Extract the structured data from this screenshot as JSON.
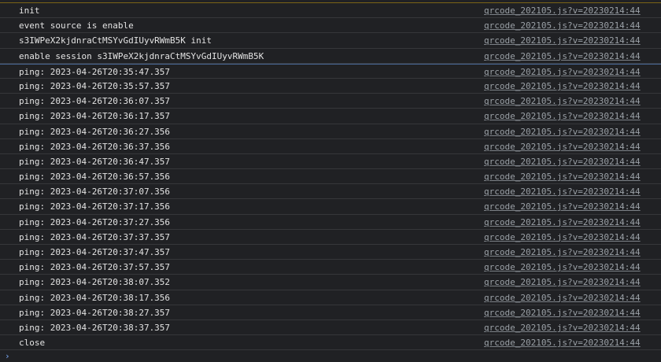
{
  "colors": {
    "background": "#202124",
    "text": "#e3e3e3",
    "source_link": "#9aa0a6",
    "prompt": "#7cacf8"
  },
  "top_fragment": "",
  "console": {
    "selected_row": 4,
    "entries": [
      {
        "message": "init",
        "source": "qrcode_202105.js?v=20230214:44"
      },
      {
        "message": "event source is enable",
        "source": "qrcode_202105.js?v=20230214:44"
      },
      {
        "message": "s3IWPeX2kjdnraCtMSYvGdIUyvRWmB5K init",
        "source": "qrcode_202105.js?v=20230214:44"
      },
      {
        "message": "enable session s3IWPeX2kjdnraCtMSYvGdIUyvRWmB5K",
        "source": "qrcode_202105.js?v=20230214:44"
      },
      {
        "message": "ping: 2023-04-26T20:35:47.357",
        "source": "qrcode_202105.js?v=20230214:44"
      },
      {
        "message": "ping: 2023-04-26T20:35:57.357",
        "source": "qrcode_202105.js?v=20230214:44"
      },
      {
        "message": "ping: 2023-04-26T20:36:07.357",
        "source": "qrcode_202105.js?v=20230214:44"
      },
      {
        "message": "ping: 2023-04-26T20:36:17.357",
        "source": "qrcode_202105.js?v=20230214:44"
      },
      {
        "message": "ping: 2023-04-26T20:36:27.356",
        "source": "qrcode_202105.js?v=20230214:44"
      },
      {
        "message": "ping: 2023-04-26T20:36:37.356",
        "source": "qrcode_202105.js?v=20230214:44"
      },
      {
        "message": "ping: 2023-04-26T20:36:47.357",
        "source": "qrcode_202105.js?v=20230214:44"
      },
      {
        "message": "ping: 2023-04-26T20:36:57.356",
        "source": "qrcode_202105.js?v=20230214:44"
      },
      {
        "message": "ping: 2023-04-26T20:37:07.356",
        "source": "qrcode_202105.js?v=20230214:44"
      },
      {
        "message": "ping: 2023-04-26T20:37:17.356",
        "source": "qrcode_202105.js?v=20230214:44"
      },
      {
        "message": "ping: 2023-04-26T20:37:27.356",
        "source": "qrcode_202105.js?v=20230214:44"
      },
      {
        "message": "ping: 2023-04-26T20:37:37.357",
        "source": "qrcode_202105.js?v=20230214:44"
      },
      {
        "message": "ping: 2023-04-26T20:37:47.357",
        "source": "qrcode_202105.js?v=20230214:44"
      },
      {
        "message": "ping: 2023-04-26T20:37:57.357",
        "source": "qrcode_202105.js?v=20230214:44"
      },
      {
        "message": "ping: 2023-04-26T20:38:07.352",
        "source": "qrcode_202105.js?v=20230214:44"
      },
      {
        "message": "ping: 2023-04-26T20:38:17.356",
        "source": "qrcode_202105.js?v=20230214:44"
      },
      {
        "message": "ping: 2023-04-26T20:38:27.357",
        "source": "qrcode_202105.js?v=20230214:44"
      },
      {
        "message": "ping: 2023-04-26T20:38:37.357",
        "source": "qrcode_202105.js?v=20230214:44"
      },
      {
        "message": "close",
        "source": "qrcode_202105.js?v=20230214:44"
      }
    ]
  },
  "prompt": {
    "icon": "chevron-right-icon",
    "glyph": "›"
  }
}
